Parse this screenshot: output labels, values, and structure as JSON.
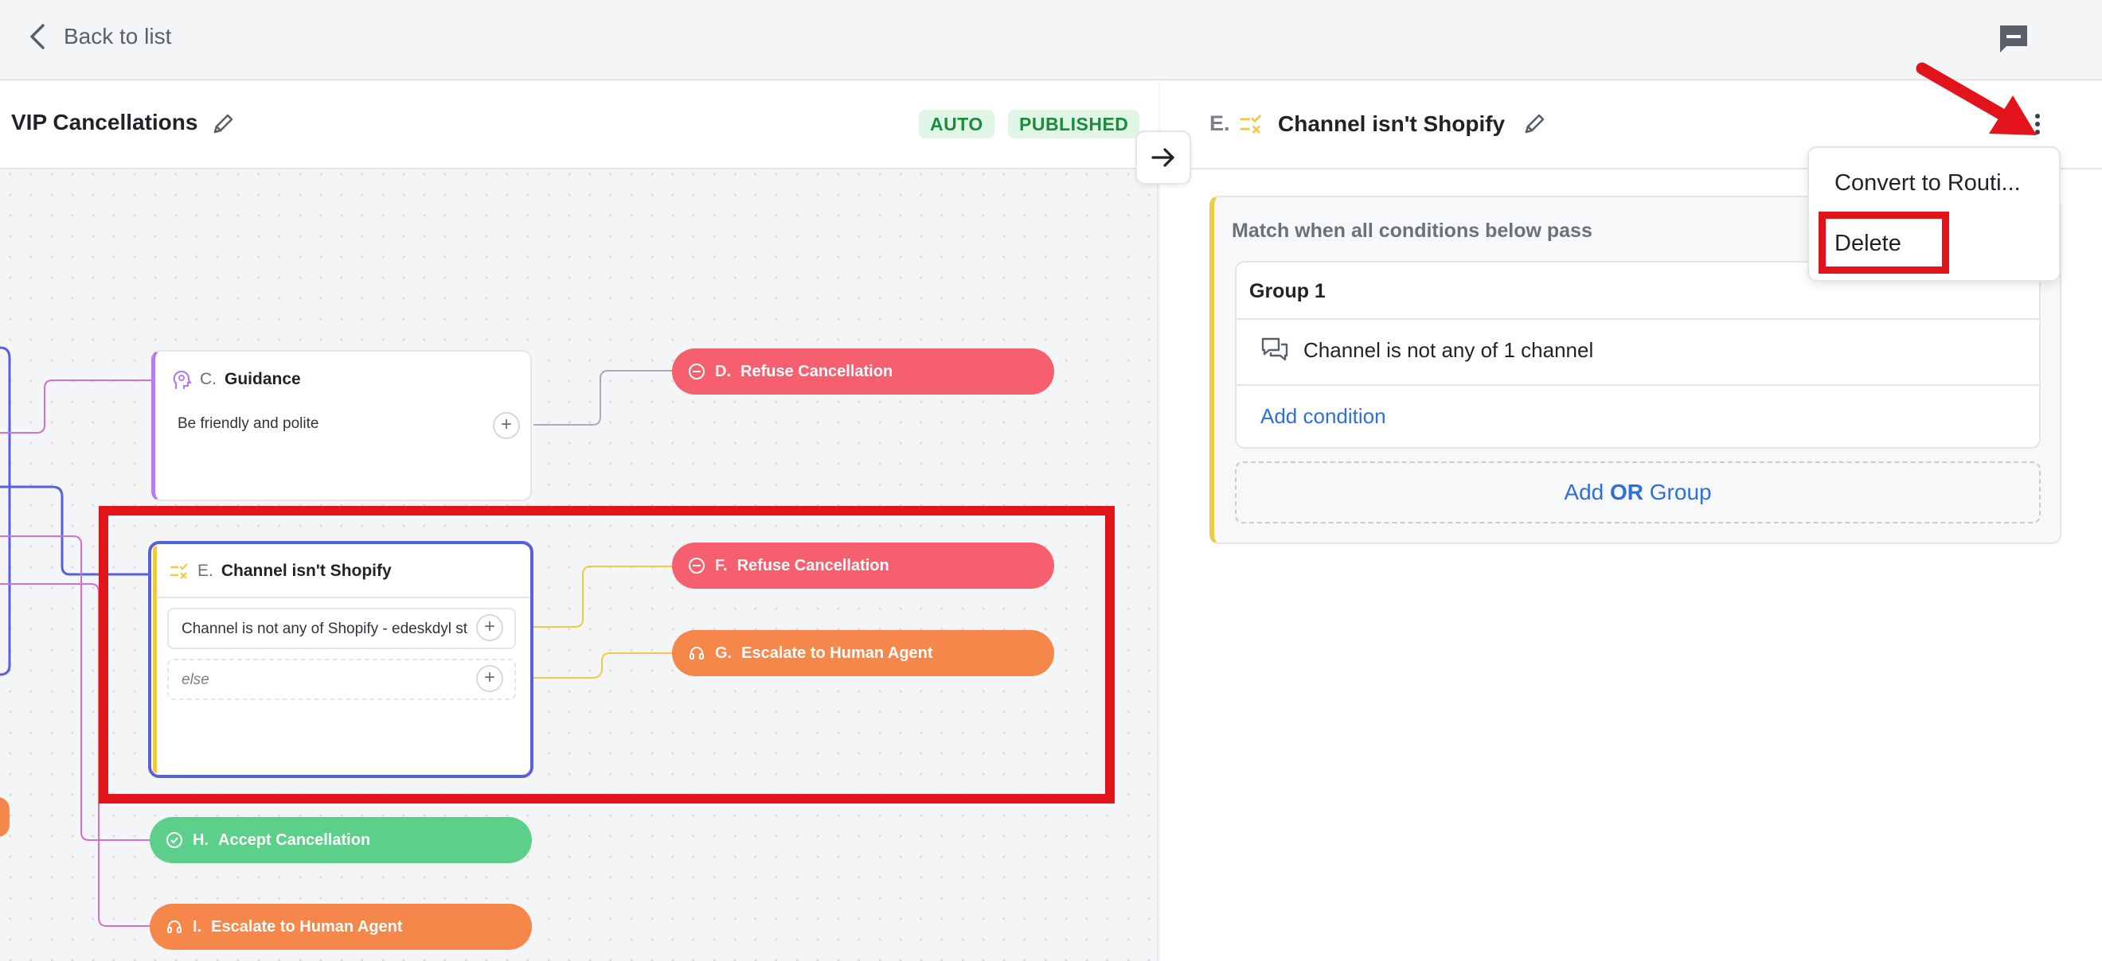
{
  "topbar": {
    "back_label": "Back to list"
  },
  "flow": {
    "title": "VIP Cancellations",
    "badges": [
      "AUTO",
      "PUBLISHED"
    ]
  },
  "nodes": {
    "guidance": {
      "letter": "C.",
      "name": "Guidance",
      "body": "Be friendly and polite"
    },
    "refuse_d": {
      "letter": "D.",
      "label": "Refuse Cancellation"
    },
    "condition_e": {
      "letter": "E.",
      "name": "Channel isn't Shopify",
      "branch_1": "Channel is not any of Shopify - edeskdyl  st",
      "branch_else": "else"
    },
    "refuse_f": {
      "letter": "F.",
      "label": "Refuse Cancellation"
    },
    "escalate_g": {
      "letter": "G.",
      "label": "Escalate to Human Agent"
    },
    "accept_h": {
      "letter": "H.",
      "label": "Accept Cancellation"
    },
    "escalate_i": {
      "letter": "I.",
      "label": "Escalate to Human Agent"
    }
  },
  "detail": {
    "letter": "E.",
    "title": "Channel isn't Shopify",
    "match_label": "Match when all conditions below pass",
    "group_name": "Group 1",
    "condition_text": "Channel is not any of 1 channel",
    "add_condition": "Add condition",
    "add_or_prefix": "Add ",
    "add_or_bold": "OR",
    "add_or_suffix": " Group"
  },
  "menu": {
    "items": [
      "Convert to Routi...",
      "Delete"
    ]
  },
  "colors": {
    "accent_blue": "#2e6fd9",
    "node_red": "#f6606e",
    "node_orange": "#f5874a",
    "node_green": "#5ccf8a",
    "selection_purple": "#5961d6",
    "condition_yellow": "#f1c945",
    "annotation_red": "#e3131b"
  }
}
